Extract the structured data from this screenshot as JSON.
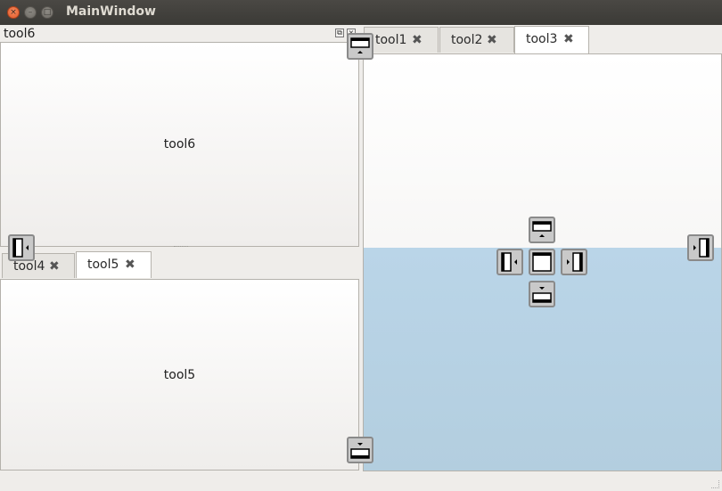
{
  "window": {
    "title": "MainWindow",
    "close_glyph": "×",
    "min_glyph": "–",
    "max_glyph": "□"
  },
  "left_top_dock": {
    "title": "tool6",
    "float_glyph": "⧉",
    "close_glyph": "×",
    "content_label": "tool6"
  },
  "left_bottom_dock": {
    "tabs": [
      {
        "label": "tool4",
        "close": "✖"
      },
      {
        "label": "tool5",
        "close": "✖"
      }
    ],
    "active_tab": "tool5",
    "content_label": "tool5"
  },
  "right_dock": {
    "tabs": [
      {
        "label": "tool1",
        "close": "✖"
      },
      {
        "label": "tool2",
        "close": "✖"
      },
      {
        "label": "tool3",
        "close": "✖"
      }
    ],
    "active_tab": "tool3"
  },
  "drop_indicators": [
    "dock-top",
    "dock-left",
    "dock-center",
    "dock-right",
    "dock-bottom",
    "outer-top",
    "outer-left",
    "outer-right",
    "outer-bottom"
  ],
  "colors": {
    "drop_highlight": "#b8d3e6",
    "titlebar": "#3c3b37",
    "close_button": "#e95420"
  }
}
